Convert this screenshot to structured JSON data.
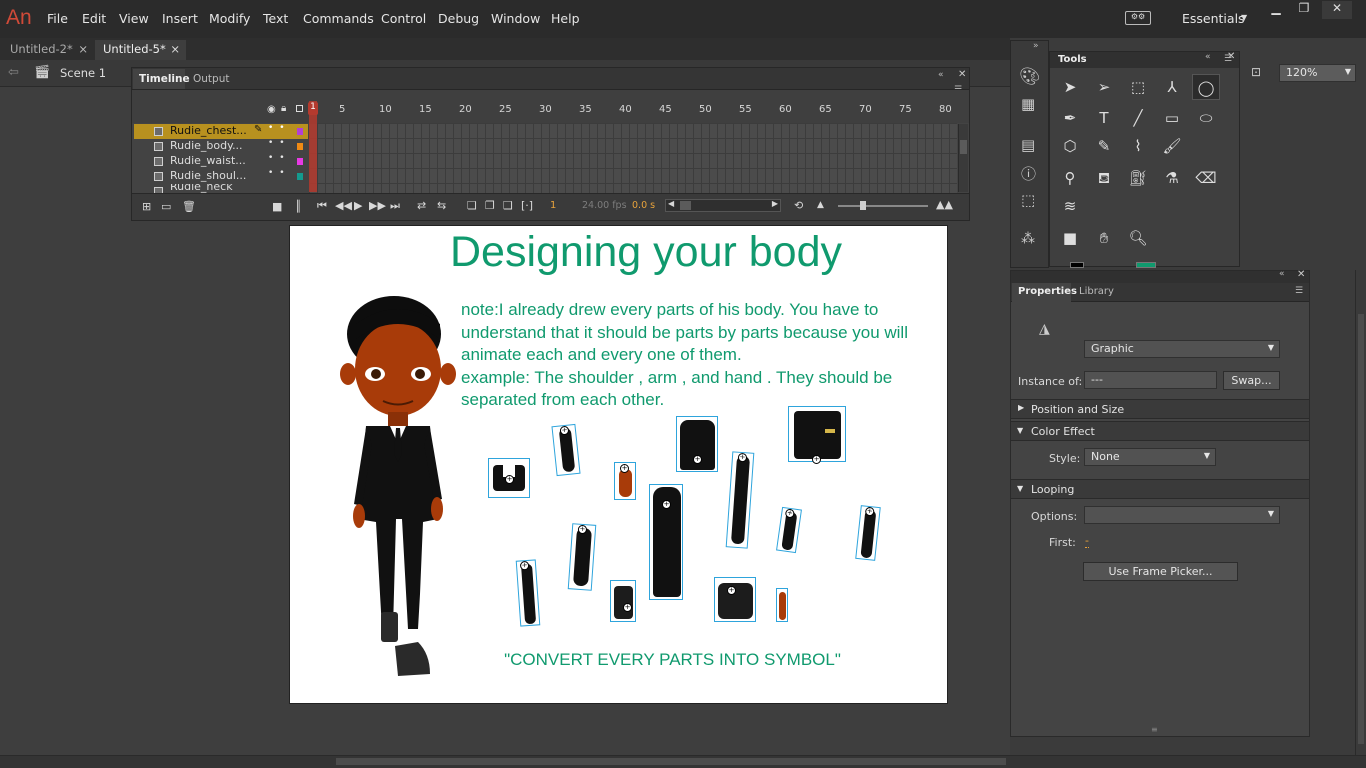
{
  "app": {
    "logo": "An"
  },
  "menu": [
    "File",
    "Edit",
    "View",
    "Insert",
    "Modify",
    "Text",
    "Commands",
    "Control",
    "Debug",
    "Window",
    "Help"
  ],
  "workspace": {
    "label": "Essentials"
  },
  "doc_tabs": [
    {
      "label": "Untitled-2*",
      "active": false
    },
    {
      "label": "Untitled-5*",
      "active": true
    }
  ],
  "editbar": {
    "scene": "Scene 1",
    "zoom": "120%"
  },
  "timeline": {
    "tabs": [
      "Timeline",
      "Output"
    ],
    "frame_numbers": [
      "1",
      "5",
      "10",
      "15",
      "20",
      "25",
      "30",
      "35",
      "40",
      "45",
      "50",
      "55",
      "60",
      "65",
      "70",
      "75",
      "80"
    ],
    "layers": [
      {
        "name": "Rudie_chest...",
        "color": "#b23fd6"
      },
      {
        "name": "Rudie_body...",
        "color": "#f08a14"
      },
      {
        "name": "Rudie_waist...",
        "color": "#e83ae4"
      },
      {
        "name": "Rudie_shoul...",
        "color": "#149a8e"
      },
      {
        "name": "Rudie_neck",
        "color": "#888888"
      }
    ],
    "current_frame": "1",
    "fps": "24.00 fps",
    "time": "0.0 s"
  },
  "stage": {
    "title": "Designing your body",
    "note": "note:I already drew every parts of his body. You have to understand that it should be parts by parts because you will animate each and every one of them.",
    "example": "example: The shoulder , arm , and hand . They should be separated from each other.",
    "footer": "\"CONVERT EVERY PARTS INTO SYMBOL\"",
    "title_color": "#109a6e"
  },
  "tools_panel": {
    "title": "Tools"
  },
  "properties": {
    "tabs": [
      "Properties",
      "Library"
    ],
    "symbol_type": "Graphic",
    "instance_of_label": "Instance of:",
    "instance_of_value": "---",
    "swap_label": "Swap...",
    "sections": {
      "position": "Position and Size",
      "color": "Color Effect",
      "looping": "Looping"
    },
    "style_label": "Style:",
    "style_value": "None",
    "options_label": "Options:",
    "first_label": "First:",
    "first_value": "-",
    "frame_picker_label": "Use Frame Picker..."
  }
}
